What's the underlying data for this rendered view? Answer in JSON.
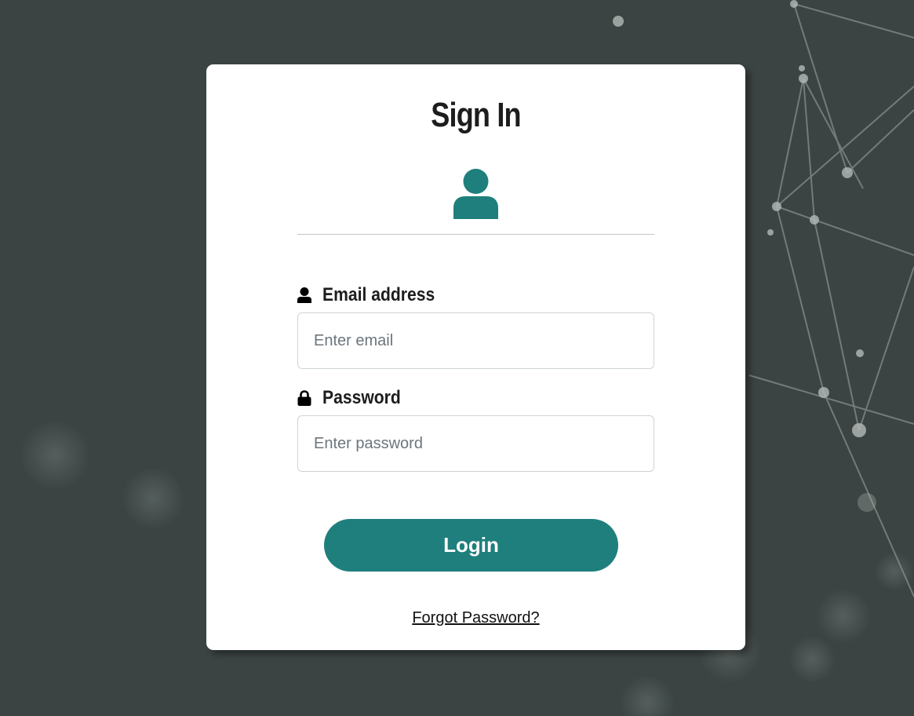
{
  "theme": {
    "background": "#3b4443",
    "card": "#ffffff",
    "accent": "#1f7f7c",
    "text": "#1d1d1d"
  },
  "signin": {
    "title": "Sign In",
    "avatar_icon": "user-avatar-icon",
    "email": {
      "label": "Email address",
      "icon": "user-icon",
      "placeholder": "Enter email",
      "value": ""
    },
    "password": {
      "label": "Password",
      "icon": "lock-icon",
      "placeholder": "Enter password",
      "value": ""
    },
    "login_label": "Login",
    "forgot_label": "Forgot Password?"
  }
}
